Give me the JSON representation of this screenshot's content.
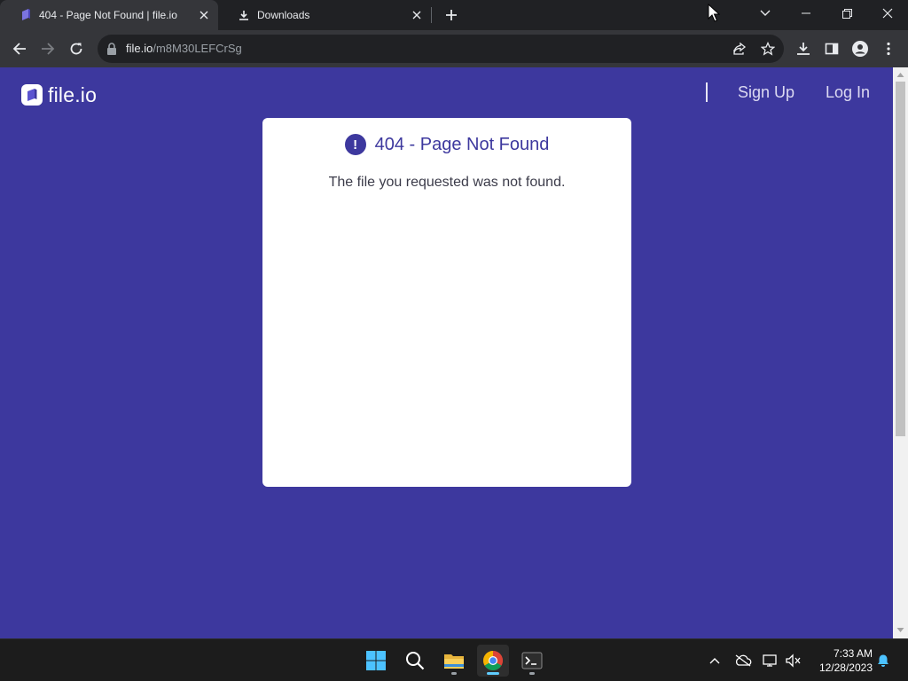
{
  "browser": {
    "tabs": [
      {
        "title": "404 - Page Not Found | file.io",
        "active": true
      },
      {
        "title": "Downloads",
        "active": false
      }
    ],
    "url_host": "file.io",
    "url_path": "/m8M30LEFCrSg"
  },
  "page": {
    "logo_text": "file.io",
    "nav": {
      "sign_up": "Sign Up",
      "log_in": "Log In"
    },
    "card": {
      "icon_glyph": "!",
      "title": "404 - Page Not Found",
      "message": "The file you requested was not found."
    },
    "colors": {
      "brand": "#3d389e",
      "card": "#ffffff"
    }
  },
  "taskbar": {
    "apps": [
      "windows-start",
      "search",
      "file-explorer",
      "chrome",
      "terminal"
    ],
    "clock": {
      "time": "7:33 AM",
      "date": "12/28/2023"
    }
  }
}
